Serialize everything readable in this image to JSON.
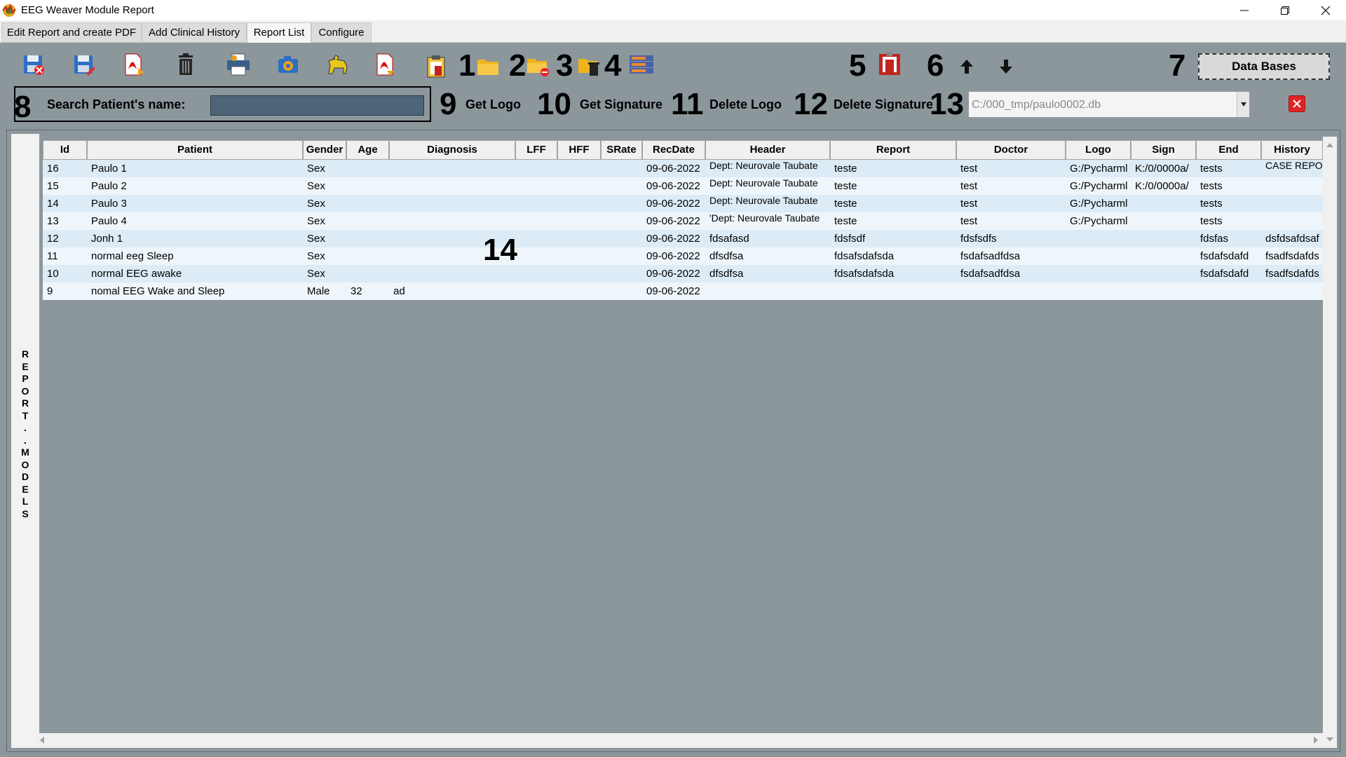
{
  "window": {
    "title": "EEG Weaver Module Report",
    "controls": [
      "minimize",
      "restore",
      "close"
    ]
  },
  "tabs": [
    {
      "label": "Edit Report and create PDF",
      "active": false
    },
    {
      "label": "Add Clinical History",
      "active": false
    },
    {
      "label": "Report List",
      "active": true
    },
    {
      "label": "Configure",
      "active": false
    }
  ],
  "toolbar": {
    "icons": [
      "save-close-icon",
      "save-as-icon",
      "pdf-export-icon",
      "trash-icon",
      "printer-icon",
      "camera-icon",
      "horse-icon",
      "pdf-open-icon",
      "clipboard-icon"
    ],
    "numbers": {
      "n1": "1",
      "n2": "2",
      "n3": "3",
      "n4": "4",
      "n5": "5",
      "n6": "6",
      "n7": "7",
      "n8": "8",
      "n9": "9",
      "n10": "10",
      "n11": "11",
      "n12": "12",
      "n13": "13",
      "n14": "14"
    },
    "data_bases_label": "Data Bases"
  },
  "search": {
    "label": "Search Patient's name:",
    "value": ""
  },
  "actions": {
    "get_logo": "Get Logo",
    "get_signature": "Get Signature",
    "delete_logo": "Delete Logo",
    "delete_signature": "Delete Signature"
  },
  "db_combo": {
    "value": "C:/000_tmp/paulo0002.db"
  },
  "side_label": "REPORT..MODELS",
  "table": {
    "columns": [
      "Id",
      "Patient",
      "Gender",
      "Age",
      "Diagnosis",
      "LFF",
      "HFF",
      "SRate",
      "RecDate",
      "Header",
      "Report",
      "Doctor",
      "Logo",
      "Sign",
      "End",
      "History"
    ],
    "rows": [
      {
        "id": "16",
        "patient": "Paulo 1",
        "gender": "Sex",
        "age": "",
        "diagnosis": "",
        "lff": "",
        "hff": "",
        "srate": "",
        "recdate": "09-06-2022",
        "header": "Dept: Neurovale Taubate",
        "report": "teste",
        "doctor": "test",
        "logo": "G:/Pycharml",
        "sign": "K:/0/0000a/",
        "end": "tests",
        "history": "CASE REPOR"
      },
      {
        "id": "15",
        "patient": "Paulo 2",
        "gender": "Sex",
        "age": "",
        "diagnosis": "",
        "lff": "",
        "hff": "",
        "srate": "",
        "recdate": "09-06-2022",
        "header": "Dept: Neurovale Taubate",
        "report": "teste",
        "doctor": "test",
        "logo": "G:/Pycharml",
        "sign": "K:/0/0000a/",
        "end": "tests",
        "history": ""
      },
      {
        "id": "14",
        "patient": "Paulo 3",
        "gender": "Sex",
        "age": "",
        "diagnosis": "",
        "lff": "",
        "hff": "",
        "srate": "",
        "recdate": "09-06-2022",
        "header": "Dept: Neurovale Taubate",
        "report": "teste",
        "doctor": "test",
        "logo": "G:/Pycharml",
        "sign": "",
        "end": "tests",
        "history": ""
      },
      {
        "id": "13",
        "patient": "Paulo 4",
        "gender": "Sex",
        "age": "",
        "diagnosis": "",
        "lff": "",
        "hff": "",
        "srate": "",
        "recdate": "09-06-2022",
        "header": "'Dept: Neurovale Taubate",
        "report": "teste",
        "doctor": "test",
        "logo": "G:/Pycharml",
        "sign": "",
        "end": "tests",
        "history": ""
      },
      {
        "id": "12",
        "patient": "Jonh 1",
        "gender": "Sex",
        "age": "",
        "diagnosis": "",
        "lff": "",
        "hff": "",
        "srate": "",
        "recdate": "09-06-2022",
        "header": "fdsafasd",
        "report": "fdsfsdf",
        "doctor": "fdsfsdfs",
        "logo": "",
        "sign": "",
        "end": "fdsfas",
        "history": "dsfdsafdsaf"
      },
      {
        "id": "11",
        "patient": "normal eeg Sleep",
        "gender": "Sex",
        "age": "",
        "diagnosis": "",
        "lff": "",
        "hff": "",
        "srate": "",
        "recdate": "09-06-2022",
        "header": "dfsdfsa",
        "report": "fdsafsdafsda",
        "doctor": "fsdafsadfdsa",
        "logo": "",
        "sign": "",
        "end": "fsdafsdafd",
        "history": "fsadfsdafds"
      },
      {
        "id": "10",
        "patient": "normal EEG awake",
        "gender": "Sex",
        "age": "",
        "diagnosis": "",
        "lff": "",
        "hff": "",
        "srate": "",
        "recdate": "09-06-2022",
        "header": "dfsdfsa",
        "report": "fdsafsdafsda",
        "doctor": "fsdafsadfdsa",
        "logo": "",
        "sign": "",
        "end": "fsdafsdafd",
        "history": "fsadfsdafds"
      },
      {
        "id": "9",
        "patient": "nomal EEG Wake and Sleep",
        "gender": "Male",
        "age": "32",
        "diagnosis": "ad",
        "lff": "",
        "hff": "",
        "srate": "",
        "recdate": "09-06-2022",
        "header": "",
        "report": "",
        "doctor": "",
        "logo": "",
        "sign": "",
        "end": "",
        "history": ""
      }
    ]
  },
  "colors": {
    "panel_bg": "#8c979c",
    "row_bg": "#dcebf5",
    "search_input_bg": "#4d6577",
    "close_red": "#e02424"
  }
}
